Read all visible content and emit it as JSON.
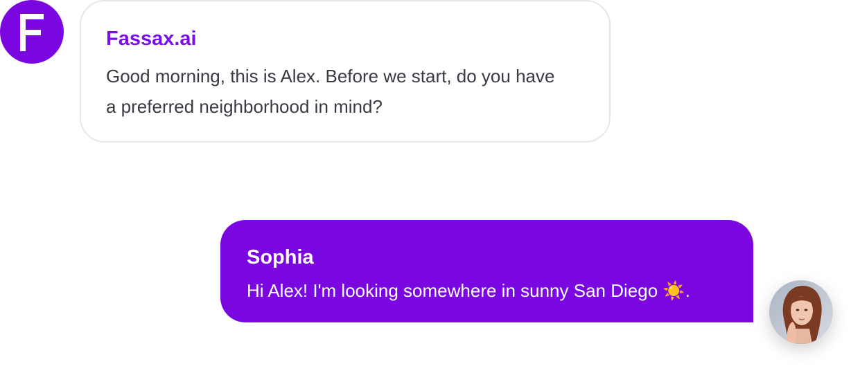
{
  "bot": {
    "logo_letter": "F",
    "name": "Fassax.ai",
    "message": "Good morning, this is Alex. Before we start, do you have a preferred neighborhood in mind?"
  },
  "user": {
    "name": "Sophia",
    "message": "Hi Alex! I'm looking somewhere in sunny San Diego ☀️."
  },
  "colors": {
    "brand": "#7a06e0",
    "bot_name": "#7a10e8",
    "user_bubble": "#7a06e0",
    "bot_bubble_border": "#e6e6ec",
    "text_dark": "#3a3a44"
  },
  "icons": {
    "bot_avatar": "fassax-logo-icon",
    "user_avatar": "user-photo-avatar"
  }
}
